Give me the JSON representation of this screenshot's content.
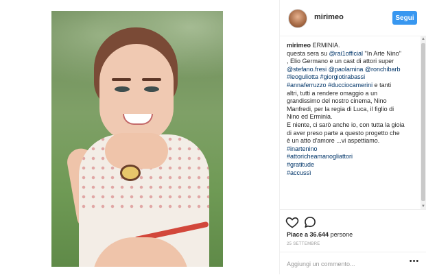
{
  "post": {
    "username": "mirimeo",
    "follow_label": "Segui",
    "photo_icon": "portrait-photo"
  },
  "caption": {
    "author": "mirimeo",
    "lines": [
      {
        "parts": [
          {
            "t": "ERMINIA.",
            "tag": false
          }
        ]
      },
      {
        "parts": [
          {
            "t": "questa sera su ",
            "tag": false
          },
          {
            "t": "@rai1official",
            "tag": true
          },
          {
            "t": " \"In Arte Nino\"",
            "tag": false
          }
        ]
      },
      {
        "parts": [
          {
            "t": ", Elio Germano e un cast di attori super",
            "tag": false
          }
        ]
      },
      {
        "parts": [
          {
            "t": "@stefano.fresi",
            "tag": true
          },
          {
            "t": " ",
            "tag": false
          },
          {
            "t": "@paolamina",
            "tag": true
          },
          {
            "t": " ",
            "tag": false
          },
          {
            "t": "@ronchibarb",
            "tag": true
          }
        ]
      },
      {
        "parts": [
          {
            "t": "#leoguliotta",
            "tag": true
          },
          {
            "t": " ",
            "tag": false
          },
          {
            "t": "#giorgiotirabassi",
            "tag": true
          }
        ]
      },
      {
        "parts": [
          {
            "t": "#annaferruzzo",
            "tag": true
          },
          {
            "t": " ",
            "tag": false
          },
          {
            "t": "#ducciocamerini",
            "tag": true
          },
          {
            "t": " e tanti",
            "tag": false
          }
        ]
      },
      {
        "parts": [
          {
            "t": "altri, tutti a rendere omaggio a un",
            "tag": false
          }
        ]
      },
      {
        "parts": [
          {
            "t": "grandissimo del nostro cinema, Nino",
            "tag": false
          }
        ]
      },
      {
        "parts": [
          {
            "t": "Manfredi, per la regia di Luca, il figlio di",
            "tag": false
          }
        ]
      },
      {
        "parts": [
          {
            "t": "Nino ed Erminia.",
            "tag": false
          }
        ]
      },
      {
        "parts": [
          {
            "t": "E niente, ci sarò anche io, con tutta la gioia",
            "tag": false
          }
        ]
      },
      {
        "parts": [
          {
            "t": "di aver preso parte a questo progetto che",
            "tag": false
          }
        ]
      },
      {
        "parts": [
          {
            "t": "è un atto d'amore ...vi aspettiamo.",
            "tag": false
          }
        ]
      },
      {
        "parts": [
          {
            "t": "#inartenino",
            "tag": true
          }
        ]
      },
      {
        "parts": [
          {
            "t": "#attoricheamanogliattori",
            "tag": true
          }
        ]
      },
      {
        "parts": [
          {
            "t": "#gratitude",
            "tag": true
          }
        ]
      },
      {
        "parts": [
          {
            "t": "#accussì",
            "tag": true
          }
        ]
      }
    ]
  },
  "actions": {
    "like_icon": "heart-icon",
    "comment_icon": "comment-bubble-icon",
    "likes_count": "Piace a 36.644",
    "likes_suffix": " persone",
    "date": "25 SETTEMBRE"
  },
  "comment_box": {
    "placeholder": "Aggiungi un commento...",
    "more_label": "•••"
  },
  "colors": {
    "follow_button": "#3897f0",
    "tag_link": "#003569",
    "text": "#262626",
    "muted": "#999999"
  }
}
